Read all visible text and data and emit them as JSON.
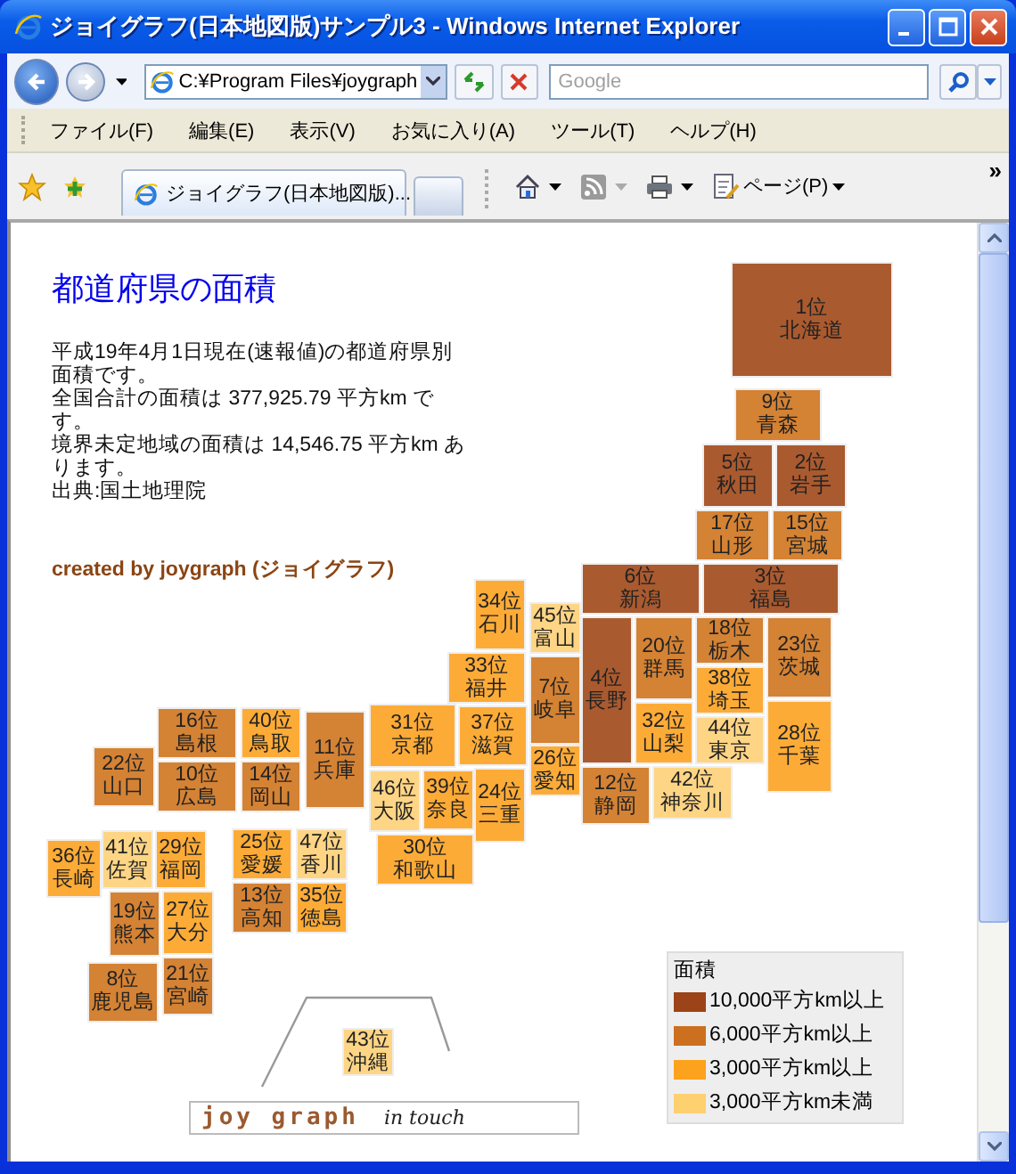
{
  "window": {
    "title": "ジョイグラフ(日本地図版)サンプル3 - Windows Internet Explorer"
  },
  "address_bar": {
    "value": "C:¥Program Files¥joygraph"
  },
  "search": {
    "placeholder": "Google"
  },
  "menu": [
    "ファイル(F)",
    "編集(E)",
    "表示(V)",
    "お気に入り(A)",
    "ツール(T)",
    "ヘルプ(H)"
  ],
  "tab": {
    "title": "ジョイグラフ(日本地図版)..."
  },
  "command_bar": {
    "page_label": "ページ(P)",
    "overflow": "»"
  },
  "page": {
    "heading": "都道府県の面積",
    "paragraphs": [
      "平成19年4月1日現在(速報値)の都道府県別面積です。",
      "全国合計の面積は 377,925.79 平方km です。",
      "境界未定地域の面積は 14,546.75 平方km あります。",
      "出典:国土地理院"
    ],
    "credit": "created by joygraph (ジョイグラフ)"
  },
  "tiles": [
    {
      "rank": "1位",
      "name": "北海道",
      "color": "#aa5a2f"
    },
    {
      "rank": "9位",
      "name": "青森",
      "color": "#d48234"
    },
    {
      "rank": "5位",
      "name": "秋田",
      "color": "#aa5a2f"
    },
    {
      "rank": "2位",
      "name": "岩手",
      "color": "#aa5a2f"
    },
    {
      "rank": "17位",
      "name": "山形",
      "color": "#d48234"
    },
    {
      "rank": "15位",
      "name": "宮城",
      "color": "#d48234"
    },
    {
      "rank": "6位",
      "name": "新潟",
      "color": "#aa5a2f"
    },
    {
      "rank": "3位",
      "name": "福島",
      "color": "#aa5a2f"
    },
    {
      "rank": "34位",
      "name": "石川",
      "color": "#fdab37"
    },
    {
      "rank": "45位",
      "name": "富山",
      "color": "#fed585"
    },
    {
      "rank": "4位",
      "name": "長野",
      "color": "#aa5a2f"
    },
    {
      "rank": "20位",
      "name": "群馬",
      "color": "#d48234"
    },
    {
      "rank": "18位",
      "name": "栃木",
      "color": "#d48234"
    },
    {
      "rank": "23位",
      "name": "茨城",
      "color": "#d48234"
    },
    {
      "rank": "33位",
      "name": "福井",
      "color": "#fdab37"
    },
    {
      "rank": "7位",
      "name": "岐阜",
      "color": "#d48234"
    },
    {
      "rank": "38位",
      "name": "埼玉",
      "color": "#fdab37"
    },
    {
      "rank": "16位",
      "name": "島根",
      "color": "#d48234"
    },
    {
      "rank": "40位",
      "name": "鳥取",
      "color": "#fdab37"
    },
    {
      "rank": "11位",
      "name": "兵庫",
      "color": "#d48234"
    },
    {
      "rank": "31位",
      "name": "京都",
      "color": "#fdab37"
    },
    {
      "rank": "37位",
      "name": "滋賀",
      "color": "#fdab37"
    },
    {
      "rank": "32位",
      "name": "山梨",
      "color": "#fdab37"
    },
    {
      "rank": "44位",
      "name": "東京",
      "color": "#fed585"
    },
    {
      "rank": "28位",
      "name": "千葉",
      "color": "#fdab37"
    },
    {
      "rank": "22位",
      "name": "山口",
      "color": "#d48234"
    },
    {
      "rank": "10位",
      "name": "広島",
      "color": "#d48234"
    },
    {
      "rank": "14位",
      "name": "岡山",
      "color": "#d48234"
    },
    {
      "rank": "46位",
      "name": "大阪",
      "color": "#fed585"
    },
    {
      "rank": "39位",
      "name": "奈良",
      "color": "#fdab37"
    },
    {
      "rank": "24位",
      "name": "三重",
      "color": "#fdab37"
    },
    {
      "rank": "26位",
      "name": "愛知",
      "color": "#fdab37"
    },
    {
      "rank": "12位",
      "name": "静岡",
      "color": "#d48234"
    },
    {
      "rank": "42位",
      "name": "神奈川",
      "color": "#fed585"
    },
    {
      "rank": "36位",
      "name": "長崎",
      "color": "#fdab37"
    },
    {
      "rank": "41位",
      "name": "佐賀",
      "color": "#fed585"
    },
    {
      "rank": "29位",
      "name": "福岡",
      "color": "#fdab37"
    },
    {
      "rank": "25位",
      "name": "愛媛",
      "color": "#fdab37"
    },
    {
      "rank": "47位",
      "name": "香川",
      "color": "#fed585"
    },
    {
      "rank": "30位",
      "name": "和歌山",
      "color": "#fdab37"
    },
    {
      "rank": "19位",
      "name": "熊本",
      "color": "#d48234"
    },
    {
      "rank": "27位",
      "name": "大分",
      "color": "#fdab37"
    },
    {
      "rank": "13位",
      "name": "高知",
      "color": "#d48234"
    },
    {
      "rank": "35位",
      "name": "徳島",
      "color": "#fdab37"
    },
    {
      "rank": "8位",
      "name": "鹿児島",
      "color": "#d48234"
    },
    {
      "rank": "21位",
      "name": "宮崎",
      "color": "#d48234"
    },
    {
      "rank": "43位",
      "name": "沖縄",
      "color": "#fed585"
    }
  ],
  "legend": {
    "title": "面積",
    "items": [
      {
        "label": "10,000平方km以上",
        "color": "#9c4317"
      },
      {
        "label": "6,000平方km以上",
        "color": "#cc7020"
      },
      {
        "label": "3,000平方km以上",
        "color": "#fca21c"
      },
      {
        "label": "3,000平方km未満",
        "color": "#fed070"
      }
    ]
  },
  "logo": {
    "name": "joy graph",
    "tagline": "in touch"
  }
}
